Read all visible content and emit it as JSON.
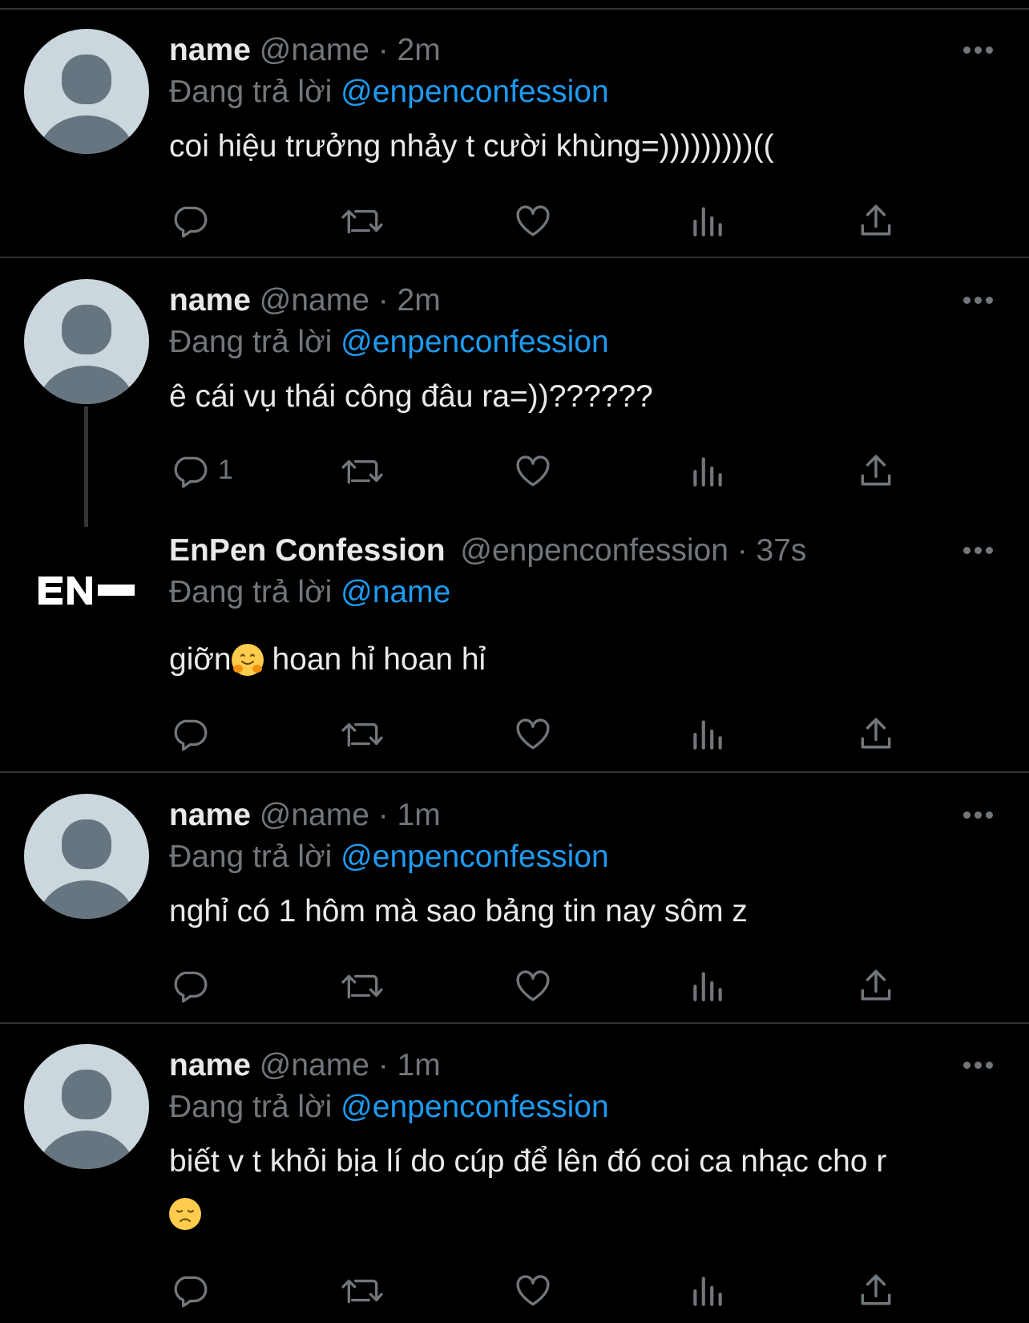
{
  "tweets": [
    {
      "name": "name",
      "meta": "@name · 2m",
      "reply_prefix": "Đang trả lời",
      "reply_to": "@enpenconfession",
      "text": "coi hiệu trưởng nhảy t cười khùng=)))))))))(("
    },
    {
      "name": "name",
      "meta": "@name · 2m",
      "reply_prefix": "Đang trả lời",
      "reply_to": "@enpenconfession",
      "text": "ê cái vụ thái công đâu ra=))??????",
      "reply_count": "1"
    },
    {
      "name": "EnPen Confession",
      "meta": "@enpenconfession · 37s",
      "reply_prefix": "Đang trả lời",
      "reply_to": "@name",
      "text_before": "giỡn",
      "text_after": " hoan hỉ hoan hỉ",
      "logo_text": "EN"
    },
    {
      "name": "name",
      "meta": "@name · 1m",
      "reply_prefix": "Đang trả lời",
      "reply_to": "@enpenconfession",
      "text": "nghỉ có 1 hôm mà sao bảng tin nay sôm z"
    },
    {
      "name": "name",
      "meta": "@name · 1m",
      "reply_prefix": "Đang trả lời",
      "reply_to": "@enpenconfession",
      "text": "biết v t khỏi bịa lí do cúp để lên đó coi ca nhạc cho r"
    }
  ],
  "icons": {
    "reply": "reply-icon",
    "retweet": "retweet-icon",
    "like": "heart-icon",
    "views": "views-icon",
    "share": "share-icon",
    "more": "more-icon"
  },
  "colors": {
    "background": "#000000",
    "text": "#e7e9ea",
    "muted": "#71767b",
    "link": "#1d9bf0",
    "divider": "#2f3336"
  }
}
